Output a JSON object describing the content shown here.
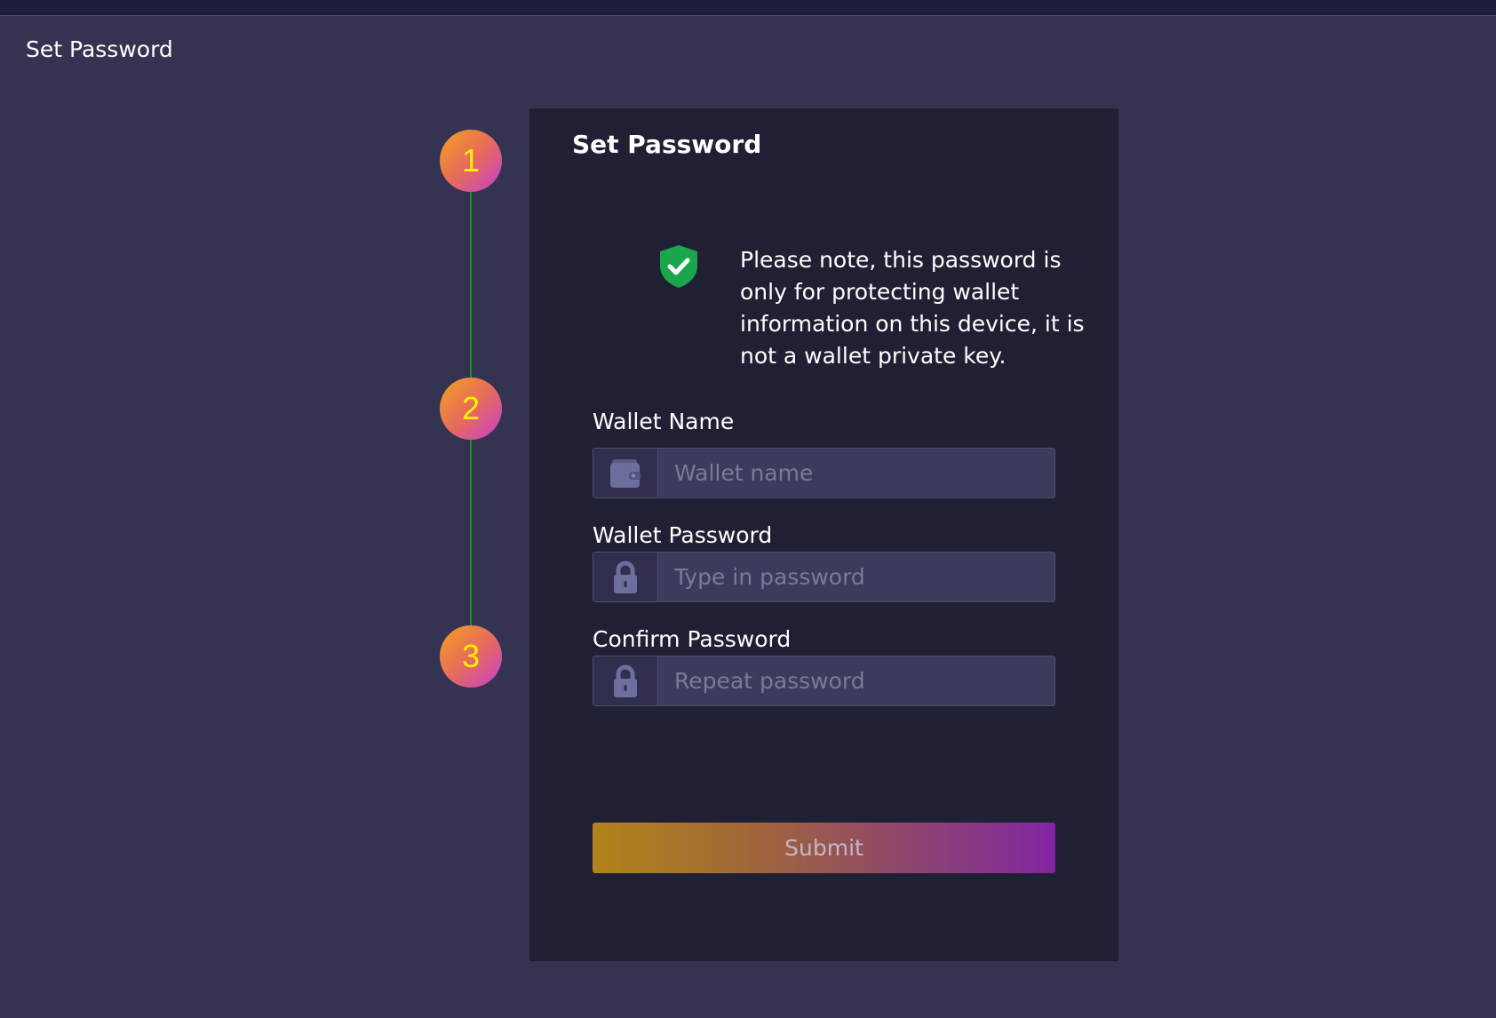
{
  "header": {
    "title": "Set Password"
  },
  "stepper": {
    "steps": [
      "1",
      "2",
      "3"
    ],
    "line_color": "#1e8a2a",
    "number_color": "#fff200"
  },
  "card": {
    "title": "Set Password",
    "notice_icon": "shield-check-icon",
    "notice_text": "Please note, this password is only for protecting wallet information on this device, it is not a wallet private key.",
    "fields": {
      "wallet_name": {
        "label": "Wallet Name",
        "placeholder": "Wallet name",
        "value": "",
        "icon": "wallet-icon"
      },
      "wallet_password": {
        "label": "Wallet Password",
        "placeholder": "Type in password",
        "value": "",
        "icon": "lock-icon"
      },
      "confirm_password": {
        "label": "Confirm Password",
        "placeholder": "Repeat password",
        "value": "",
        "icon": "lock-icon"
      }
    },
    "submit_label": "Submit"
  },
  "colors": {
    "background": "#343452",
    "card": "#1f2033",
    "shield": "#1aa64a",
    "icon": "#6e6e9e"
  }
}
